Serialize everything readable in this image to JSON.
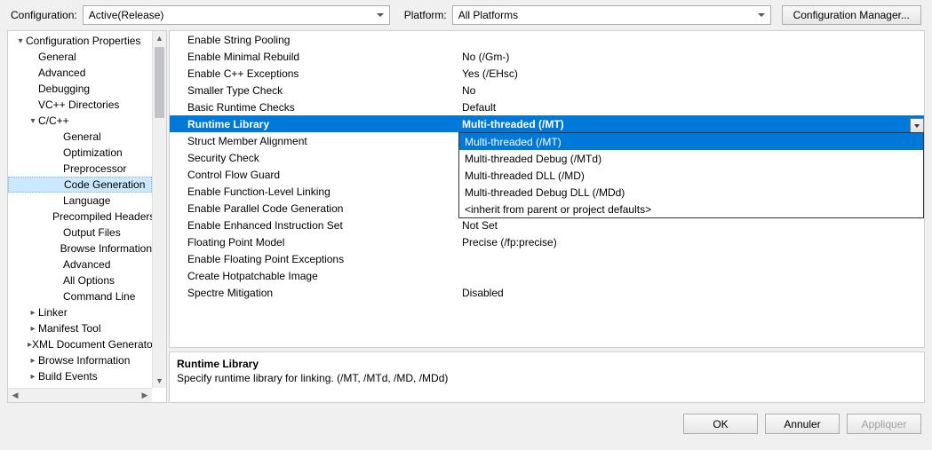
{
  "top": {
    "config_label": "Configuration:",
    "config_value": "Active(Release)",
    "platform_label": "Platform:",
    "platform_value": "All Platforms",
    "manager_btn": "Configuration Manager..."
  },
  "tree": [
    {
      "indent": 0,
      "exp": "▾",
      "label": "Configuration Properties"
    },
    {
      "indent": 1,
      "exp": "",
      "label": "General"
    },
    {
      "indent": 1,
      "exp": "",
      "label": "Advanced"
    },
    {
      "indent": 1,
      "exp": "",
      "label": "Debugging"
    },
    {
      "indent": 1,
      "exp": "",
      "label": "VC++ Directories"
    },
    {
      "indent": 1,
      "exp": "▾",
      "label": "C/C++"
    },
    {
      "indent": 2,
      "exp": "",
      "label": "General"
    },
    {
      "indent": 2,
      "exp": "",
      "label": "Optimization"
    },
    {
      "indent": 2,
      "exp": "",
      "label": "Preprocessor"
    },
    {
      "indent": 2,
      "exp": "",
      "label": "Code Generation",
      "selected": true
    },
    {
      "indent": 2,
      "exp": "",
      "label": "Language"
    },
    {
      "indent": 2,
      "exp": "",
      "label": "Precompiled Headers"
    },
    {
      "indent": 2,
      "exp": "",
      "label": "Output Files"
    },
    {
      "indent": 2,
      "exp": "",
      "label": "Browse Information"
    },
    {
      "indent": 2,
      "exp": "",
      "label": "Advanced"
    },
    {
      "indent": 2,
      "exp": "",
      "label": "All Options"
    },
    {
      "indent": 2,
      "exp": "",
      "label": "Command Line"
    },
    {
      "indent": 1,
      "exp": "▸",
      "label": "Linker"
    },
    {
      "indent": 1,
      "exp": "▸",
      "label": "Manifest Tool"
    },
    {
      "indent": 1,
      "exp": "▸",
      "label": "XML Document Generator"
    },
    {
      "indent": 1,
      "exp": "▸",
      "label": "Browse Information"
    },
    {
      "indent": 1,
      "exp": "▸",
      "label": "Build Events"
    }
  ],
  "grid": [
    {
      "name": "Enable String Pooling",
      "val": ""
    },
    {
      "name": "Enable Minimal Rebuild",
      "val": "No (/Gm-)"
    },
    {
      "name": "Enable C++ Exceptions",
      "val": "Yes (/EHsc)"
    },
    {
      "name": "Smaller Type Check",
      "val": "No"
    },
    {
      "name": "Basic Runtime Checks",
      "val": "Default"
    },
    {
      "name": "Runtime Library",
      "val": "Multi-threaded (/MT)",
      "selected": true
    },
    {
      "name": "Struct Member Alignment",
      "val": ""
    },
    {
      "name": "Security Check",
      "val": ""
    },
    {
      "name": "Control Flow Guard",
      "val": ""
    },
    {
      "name": "Enable Function-Level Linking",
      "val": ""
    },
    {
      "name": "Enable Parallel Code Generation",
      "val": ""
    },
    {
      "name": "Enable Enhanced Instruction Set",
      "val": "Not Set"
    },
    {
      "name": "Floating Point Model",
      "val": "Precise (/fp:precise)"
    },
    {
      "name": "Enable Floating Point Exceptions",
      "val": ""
    },
    {
      "name": "Create Hotpatchable Image",
      "val": ""
    },
    {
      "name": "Spectre Mitigation",
      "val": "Disabled"
    }
  ],
  "dropdown": [
    "Multi-threaded (/MT)",
    "Multi-threaded Debug (/MTd)",
    "Multi-threaded DLL (/MD)",
    "Multi-threaded Debug DLL (/MDd)",
    "<inherit from parent or project defaults>"
  ],
  "desc": {
    "title": "Runtime Library",
    "text": "Specify runtime library for linking.     (/MT, /MTd, /MD, /MDd)"
  },
  "buttons": {
    "ok": "OK",
    "cancel": "Annuler",
    "apply": "Appliquer"
  }
}
